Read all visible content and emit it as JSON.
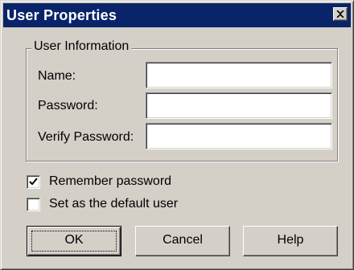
{
  "window": {
    "title": "User Properties",
    "close_icon": "close-icon"
  },
  "group": {
    "legend": "User Information"
  },
  "fields": {
    "name": {
      "label": "Name:",
      "value": ""
    },
    "password": {
      "label": "Password:",
      "value": ""
    },
    "verify_password": {
      "label": "Verify Password:",
      "value": ""
    }
  },
  "options": {
    "remember_password": {
      "label": "Remember password",
      "checked": true
    },
    "default_user": {
      "label": "Set as the default user",
      "checked": false
    }
  },
  "buttons": {
    "ok": "OK",
    "cancel": "Cancel",
    "help": "Help"
  },
  "colors": {
    "titlebar": "#0a246a",
    "face": "#d4d0c8"
  }
}
